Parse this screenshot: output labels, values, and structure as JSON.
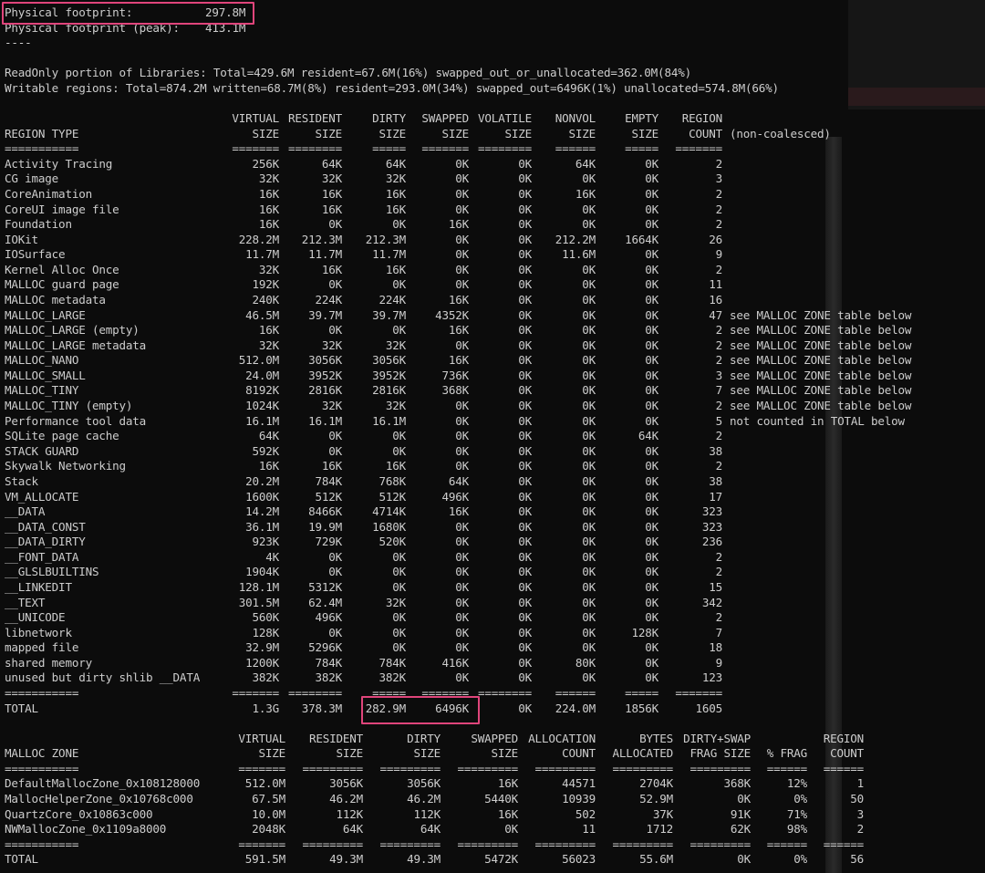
{
  "highlight_color": "#e0457b",
  "scrollbar_label": "scrollbar",
  "lines": [
    {
      "t": "kv",
      "label": "Physical footprint:",
      "value": "297.8M"
    },
    {
      "t": "kv",
      "label": "Physical footprint (peak):",
      "value": "413.1M"
    },
    {
      "t": "text",
      "text": "----"
    },
    {
      "t": "blank"
    },
    {
      "t": "text",
      "text": "ReadOnly portion of Libraries: Total=429.6M resident=67.6M(16%) swapped_out_or_unallocated=362.0M(84%)"
    },
    {
      "t": "text",
      "text": "Writable regions: Total=874.2M written=68.7M(8%) resident=293.0M(34%) swapped_out=6496K(1%) unallocated=574.8M(66%)"
    },
    {
      "t": "blank"
    },
    {
      "t": "row",
      "tb": "region",
      "cells": [
        "",
        "VIRTUAL",
        "RESIDENT",
        "DIRTY",
        "SWAPPED",
        "VOLATILE",
        "NONVOL",
        "EMPTY",
        "REGION",
        ""
      ]
    },
    {
      "t": "row",
      "tb": "region",
      "cells": [
        "REGION TYPE",
        "SIZE",
        "SIZE",
        "SIZE",
        "SIZE",
        "SIZE",
        "SIZE",
        "SIZE",
        "COUNT",
        "(non-coalesced)"
      ]
    },
    {
      "t": "row",
      "tb": "region",
      "cells": [
        "===========",
        "=======",
        "========",
        "=====",
        "=======",
        "========",
        "======",
        "=====",
        "=======",
        ""
      ]
    },
    {
      "t": "row",
      "tb": "region",
      "cells": [
        "Activity Tracing",
        "256K",
        "64K",
        "64K",
        "0K",
        "0K",
        "64K",
        "0K",
        "2",
        ""
      ]
    },
    {
      "t": "row",
      "tb": "region",
      "cells": [
        "CG image",
        "32K",
        "32K",
        "32K",
        "0K",
        "0K",
        "0K",
        "0K",
        "3",
        ""
      ]
    },
    {
      "t": "row",
      "tb": "region",
      "cells": [
        "CoreAnimation",
        "16K",
        "16K",
        "16K",
        "0K",
        "0K",
        "16K",
        "0K",
        "2",
        ""
      ]
    },
    {
      "t": "row",
      "tb": "region",
      "cells": [
        "CoreUI image file",
        "16K",
        "16K",
        "16K",
        "0K",
        "0K",
        "0K",
        "0K",
        "2",
        ""
      ]
    },
    {
      "t": "row",
      "tb": "region",
      "cells": [
        "Foundation",
        "16K",
        "0K",
        "0K",
        "16K",
        "0K",
        "0K",
        "0K",
        "2",
        ""
      ]
    },
    {
      "t": "row",
      "tb": "region",
      "cells": [
        "IOKit",
        "228.2M",
        "212.3M",
        "212.3M",
        "0K",
        "0K",
        "212.2M",
        "1664K",
        "26",
        ""
      ]
    },
    {
      "t": "row",
      "tb": "region",
      "cells": [
        "IOSurface",
        "11.7M",
        "11.7M",
        "11.7M",
        "0K",
        "0K",
        "11.6M",
        "0K",
        "9",
        ""
      ]
    },
    {
      "t": "row",
      "tb": "region",
      "cells": [
        "Kernel Alloc Once",
        "32K",
        "16K",
        "16K",
        "0K",
        "0K",
        "0K",
        "0K",
        "2",
        ""
      ]
    },
    {
      "t": "row",
      "tb": "region",
      "cells": [
        "MALLOC guard page",
        "192K",
        "0K",
        "0K",
        "0K",
        "0K",
        "0K",
        "0K",
        "11",
        ""
      ]
    },
    {
      "t": "row",
      "tb": "region",
      "cells": [
        "MALLOC metadata",
        "240K",
        "224K",
        "224K",
        "16K",
        "0K",
        "0K",
        "0K",
        "16",
        ""
      ]
    },
    {
      "t": "row",
      "tb": "region",
      "cells": [
        "MALLOC_LARGE",
        "46.5M",
        "39.7M",
        "39.7M",
        "4352K",
        "0K",
        "0K",
        "0K",
        "47",
        "see MALLOC ZONE table below"
      ]
    },
    {
      "t": "row",
      "tb": "region",
      "cells": [
        "MALLOC_LARGE (empty)",
        "16K",
        "0K",
        "0K",
        "16K",
        "0K",
        "0K",
        "0K",
        "2",
        "see MALLOC ZONE table below"
      ]
    },
    {
      "t": "row",
      "tb": "region",
      "cells": [
        "MALLOC_LARGE metadata",
        "32K",
        "32K",
        "32K",
        "0K",
        "0K",
        "0K",
        "0K",
        "2",
        "see MALLOC ZONE table below"
      ]
    },
    {
      "t": "row",
      "tb": "region",
      "cells": [
        "MALLOC_NANO",
        "512.0M",
        "3056K",
        "3056K",
        "16K",
        "0K",
        "0K",
        "0K",
        "2",
        "see MALLOC ZONE table below"
      ]
    },
    {
      "t": "row",
      "tb": "region",
      "cells": [
        "MALLOC_SMALL",
        "24.0M",
        "3952K",
        "3952K",
        "736K",
        "0K",
        "0K",
        "0K",
        "3",
        "see MALLOC ZONE table below"
      ]
    },
    {
      "t": "row",
      "tb": "region",
      "cells": [
        "MALLOC_TINY",
        "8192K",
        "2816K",
        "2816K",
        "368K",
        "0K",
        "0K",
        "0K",
        "7",
        "see MALLOC ZONE table below"
      ]
    },
    {
      "t": "row",
      "tb": "region",
      "cells": [
        "MALLOC_TINY (empty)",
        "1024K",
        "32K",
        "32K",
        "0K",
        "0K",
        "0K",
        "0K",
        "2",
        "see MALLOC ZONE table below"
      ]
    },
    {
      "t": "row",
      "tb": "region",
      "cells": [
        "Performance tool data",
        "16.1M",
        "16.1M",
        "16.1M",
        "0K",
        "0K",
        "0K",
        "0K",
        "5",
        "not counted in TOTAL below"
      ]
    },
    {
      "t": "row",
      "tb": "region",
      "cells": [
        "SQLite page cache",
        "64K",
        "0K",
        "0K",
        "0K",
        "0K",
        "0K",
        "64K",
        "2",
        ""
      ]
    },
    {
      "t": "row",
      "tb": "region",
      "cells": [
        "STACK GUARD",
        "592K",
        "0K",
        "0K",
        "0K",
        "0K",
        "0K",
        "0K",
        "38",
        ""
      ]
    },
    {
      "t": "row",
      "tb": "region",
      "cells": [
        "Skywalk Networking",
        "16K",
        "16K",
        "16K",
        "0K",
        "0K",
        "0K",
        "0K",
        "2",
        ""
      ]
    },
    {
      "t": "row",
      "tb": "region",
      "cells": [
        "Stack",
        "20.2M",
        "784K",
        "768K",
        "64K",
        "0K",
        "0K",
        "0K",
        "38",
        ""
      ]
    },
    {
      "t": "row",
      "tb": "region",
      "cells": [
        "VM_ALLOCATE",
        "1600K",
        "512K",
        "512K",
        "496K",
        "0K",
        "0K",
        "0K",
        "17",
        ""
      ]
    },
    {
      "t": "row",
      "tb": "region",
      "cells": [
        "__DATA",
        "14.2M",
        "8466K",
        "4714K",
        "16K",
        "0K",
        "0K",
        "0K",
        "323",
        ""
      ]
    },
    {
      "t": "row",
      "tb": "region",
      "cells": [
        "__DATA_CONST",
        "36.1M",
        "19.9M",
        "1680K",
        "0K",
        "0K",
        "0K",
        "0K",
        "323",
        ""
      ]
    },
    {
      "t": "row",
      "tb": "region",
      "cells": [
        "__DATA_DIRTY",
        "923K",
        "729K",
        "520K",
        "0K",
        "0K",
        "0K",
        "0K",
        "236",
        ""
      ]
    },
    {
      "t": "row",
      "tb": "region",
      "cells": [
        "__FONT_DATA",
        "4K",
        "0K",
        "0K",
        "0K",
        "0K",
        "0K",
        "0K",
        "2",
        ""
      ]
    },
    {
      "t": "row",
      "tb": "region",
      "cells": [
        "__GLSLBUILTINS",
        "1904K",
        "0K",
        "0K",
        "0K",
        "0K",
        "0K",
        "0K",
        "2",
        ""
      ]
    },
    {
      "t": "row",
      "tb": "region",
      "cells": [
        "__LINKEDIT",
        "128.1M",
        "5312K",
        "0K",
        "0K",
        "0K",
        "0K",
        "0K",
        "15",
        ""
      ]
    },
    {
      "t": "row",
      "tb": "region",
      "cells": [
        "__TEXT",
        "301.5M",
        "62.4M",
        "32K",
        "0K",
        "0K",
        "0K",
        "0K",
        "342",
        ""
      ]
    },
    {
      "t": "row",
      "tb": "region",
      "cells": [
        "__UNICODE",
        "560K",
        "496K",
        "0K",
        "0K",
        "0K",
        "0K",
        "0K",
        "2",
        ""
      ]
    },
    {
      "t": "row",
      "tb": "region",
      "cells": [
        "libnetwork",
        "128K",
        "0K",
        "0K",
        "0K",
        "0K",
        "0K",
        "128K",
        "7",
        ""
      ]
    },
    {
      "t": "row",
      "tb": "region",
      "cells": [
        "mapped file",
        "32.9M",
        "5296K",
        "0K",
        "0K",
        "0K",
        "0K",
        "0K",
        "18",
        ""
      ]
    },
    {
      "t": "row",
      "tb": "region",
      "cells": [
        "shared memory",
        "1200K",
        "784K",
        "784K",
        "416K",
        "0K",
        "80K",
        "0K",
        "9",
        ""
      ]
    },
    {
      "t": "row",
      "tb": "region",
      "cells": [
        "unused but dirty shlib __DATA",
        "382K",
        "382K",
        "382K",
        "0K",
        "0K",
        "0K",
        "0K",
        "123",
        ""
      ]
    },
    {
      "t": "row",
      "tb": "region",
      "cells": [
        "===========",
        "=======",
        "========",
        "=====",
        "=======",
        "========",
        "======",
        "=====",
        "=======",
        ""
      ]
    },
    {
      "t": "row",
      "tb": "region",
      "cells": [
        "TOTAL",
        "1.3G",
        "378.3M",
        "282.9M",
        "6496K",
        "0K",
        "224.0M",
        "1856K",
        "1605",
        ""
      ]
    },
    {
      "t": "blank"
    },
    {
      "t": "row",
      "tb": "zone",
      "cells": [
        "",
        "VIRTUAL",
        "RESIDENT",
        "DIRTY",
        "SWAPPED",
        "ALLOCATION",
        "BYTES",
        "DIRTY+SWAP",
        "",
        "REGION"
      ]
    },
    {
      "t": "row",
      "tb": "zone",
      "cells": [
        "MALLOC ZONE",
        "SIZE",
        "SIZE",
        "SIZE",
        "SIZE",
        "COUNT",
        "ALLOCATED",
        "FRAG SIZE",
        "% FRAG",
        "COUNT"
      ]
    },
    {
      "t": "row",
      "tb": "zone",
      "cells": [
        "===========",
        "=======",
        "=========",
        "=========",
        "=========",
        "=========",
        "=========",
        "=========",
        "======",
        "======"
      ]
    },
    {
      "t": "row",
      "tb": "zone",
      "cells": [
        "DefaultMallocZone_0x108128000",
        "512.0M",
        "3056K",
        "3056K",
        "16K",
        "44571",
        "2704K",
        "368K",
        "12%",
        "1"
      ]
    },
    {
      "t": "row",
      "tb": "zone",
      "cells": [
        "MallocHelperZone_0x10768c000",
        "67.5M",
        "46.2M",
        "46.2M",
        "5440K",
        "10939",
        "52.9M",
        "0K",
        "0%",
        "50"
      ]
    },
    {
      "t": "row",
      "tb": "zone",
      "cells": [
        "QuartzCore_0x10863c000",
        "10.0M",
        "112K",
        "112K",
        "16K",
        "502",
        "37K",
        "91K",
        "71%",
        "3"
      ]
    },
    {
      "t": "row",
      "tb": "zone",
      "cells": [
        "NWMallocZone_0x1109a8000",
        "2048K",
        "64K",
        "64K",
        "0K",
        "11",
        "1712",
        "62K",
        "98%",
        "2"
      ]
    },
    {
      "t": "row",
      "tb": "zone",
      "cells": [
        "===========",
        "=======",
        "=========",
        "=========",
        "=========",
        "=========",
        "=========",
        "=========",
        "======",
        "======"
      ]
    },
    {
      "t": "row",
      "tb": "zone",
      "cells": [
        "TOTAL",
        "591.5M",
        "49.3M",
        "49.3M",
        "5472K",
        "56023",
        "55.6M",
        "0K",
        "0%",
        "56"
      ]
    }
  ]
}
